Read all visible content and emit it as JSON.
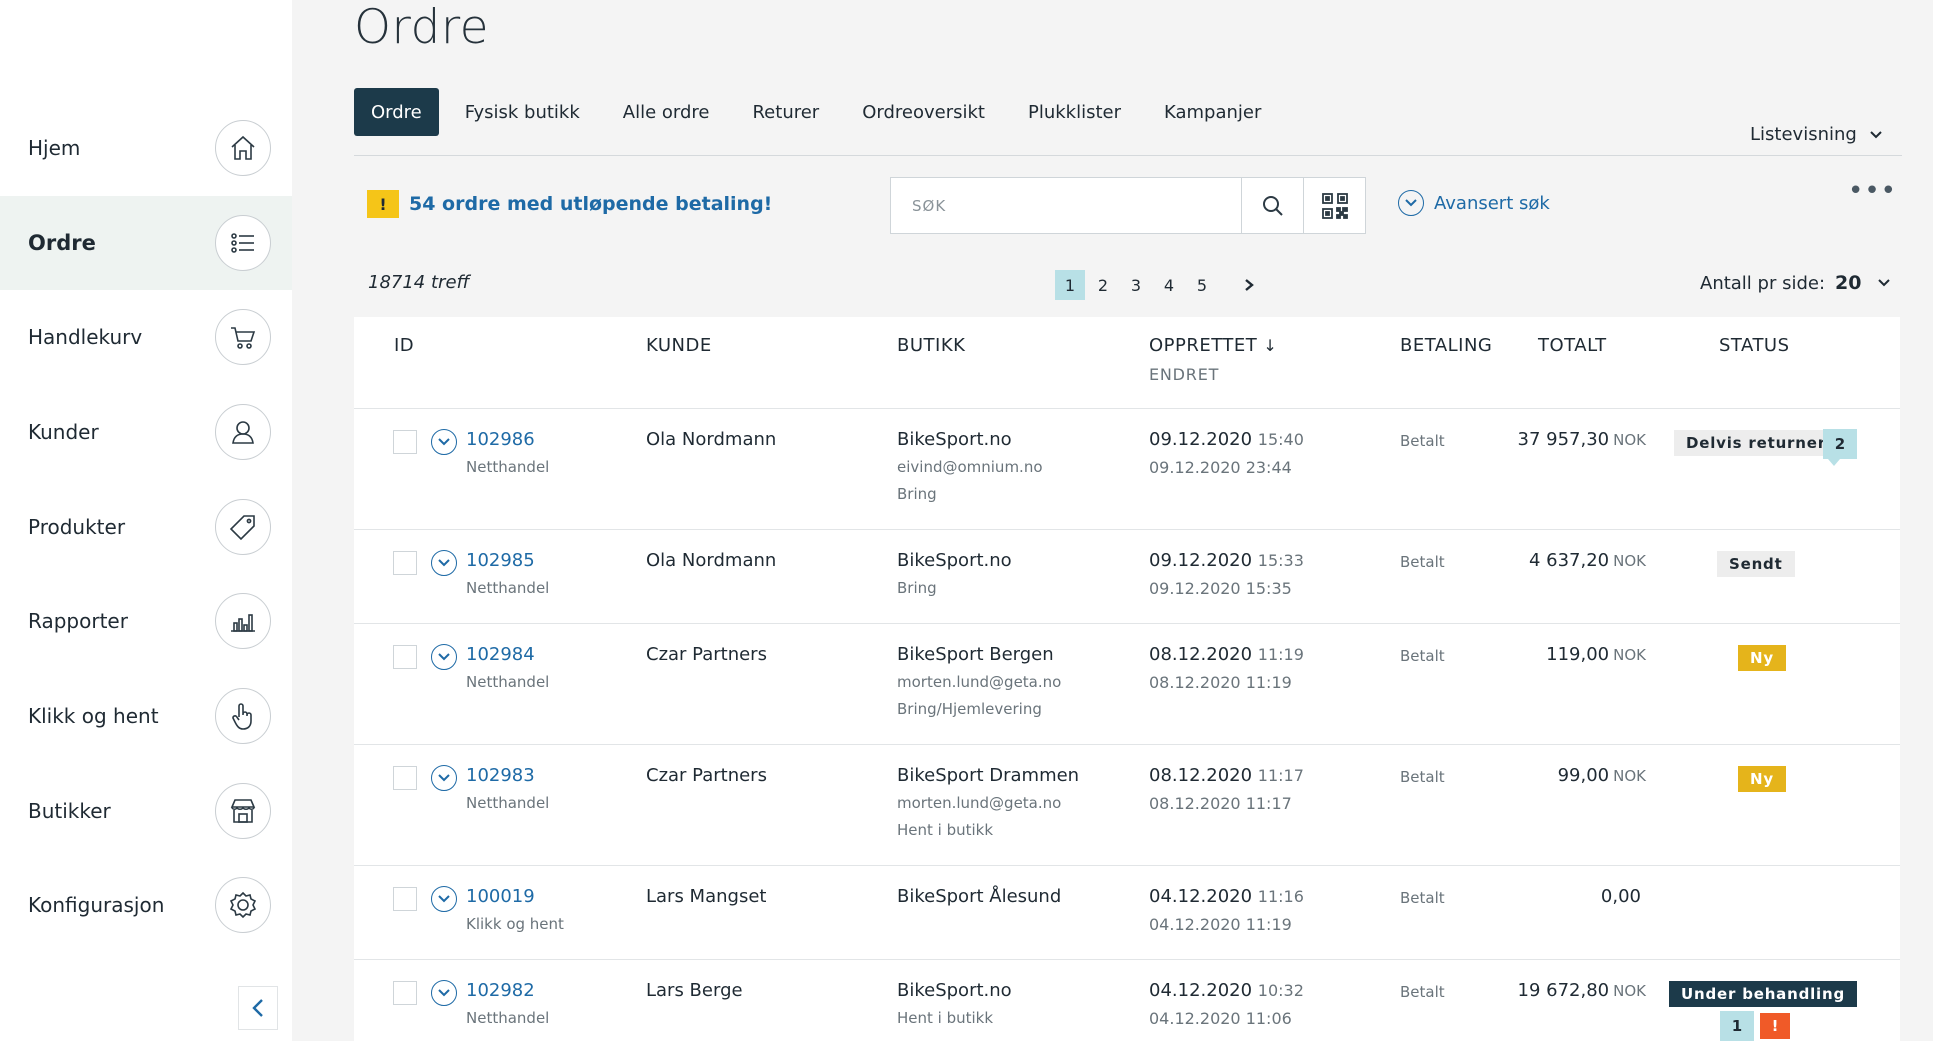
{
  "sidebar": {
    "items": [
      {
        "label": "Hjem",
        "icon": "home-icon"
      },
      {
        "label": "Ordre",
        "icon": "list-icon"
      },
      {
        "label": "Handlekurv",
        "icon": "cart-icon"
      },
      {
        "label": "Kunder",
        "icon": "user-icon"
      },
      {
        "label": "Produkter",
        "icon": "tag-icon"
      },
      {
        "label": "Rapporter",
        "icon": "bar-chart-icon"
      },
      {
        "label": "Klikk og hent",
        "icon": "hand-pointer-icon"
      },
      {
        "label": "Butikker",
        "icon": "store-icon"
      },
      {
        "label": "Konfigurasjon",
        "icon": "gear-icon"
      }
    ],
    "active": "Ordre",
    "collapse_icon": "chevron-left-icon"
  },
  "page": {
    "title": "Ordre"
  },
  "tabs": [
    "Ordre",
    "Fysisk butikk",
    "Alle ordre",
    "Returer",
    "Ordreoversikt",
    "Plukklister",
    "Kampanjer"
  ],
  "view_select": {
    "label": "Listevisning"
  },
  "alert": {
    "badge": "!",
    "text": "54 ordre med utløpende betaling!"
  },
  "search": {
    "placeholder": "SØK"
  },
  "advanced_search": {
    "label": "Avansert søk"
  },
  "more": {
    "label": "•••"
  },
  "results": {
    "hits": "18714 treff"
  },
  "pagination": {
    "pages": [
      "1",
      "2",
      "3",
      "4",
      "5"
    ],
    "current": "1"
  },
  "per_page": {
    "label": "Antall pr side:",
    "value": "20"
  },
  "table": {
    "headers": {
      "id": "ID",
      "customer": "KUNDE",
      "store": "BUTIKK",
      "created": "OPPRETTET",
      "created_sort": "↓",
      "updated": "ENDRET",
      "payment": "BETALING",
      "total": "TOTALT",
      "status": "STATUS"
    },
    "rows": [
      {
        "id": "102986",
        "channel": "Netthandel",
        "customer": "Ola Nordmann",
        "store": "BikeSport.no",
        "store_sub1": "eivind@omnium.no",
        "store_sub2": "Bring",
        "created_date": "09.12.2020",
        "created_time": "15:40",
        "updated": "09.12.2020 23:44",
        "payment": "Betalt",
        "total": "37 957,30",
        "currency": "NOK",
        "status": "Delvis returnert",
        "bubble": "2"
      },
      {
        "id": "102985",
        "channel": "Netthandel",
        "customer": "Ola Nordmann",
        "store": "BikeSport.no",
        "store_sub1": "Bring",
        "store_sub2": "",
        "created_date": "09.12.2020",
        "created_time": "15:33",
        "updated": "09.12.2020 15:35",
        "payment": "Betalt",
        "total": "4 637,20",
        "currency": "NOK",
        "status": "Sendt"
      },
      {
        "id": "102984",
        "channel": "Netthandel",
        "customer": "Czar Partners",
        "store": "BikeSport Bergen",
        "store_sub1": "morten.lund@geta.no",
        "store_sub2": "Bring/Hjemlevering",
        "created_date": "08.12.2020",
        "created_time": "11:19",
        "updated": "08.12.2020 11:19",
        "payment": "Betalt",
        "total": "119,00",
        "currency": "NOK",
        "status": "Ny"
      },
      {
        "id": "102983",
        "channel": "Netthandel",
        "customer": "Czar Partners",
        "store": "BikeSport Drammen",
        "store_sub1": "morten.lund@geta.no",
        "store_sub2": "Hent i butikk",
        "created_date": "08.12.2020",
        "created_time": "11:17",
        "updated": "08.12.2020 11:17",
        "payment": "Betalt",
        "total": "99,00",
        "currency": "NOK",
        "status": "Ny"
      },
      {
        "id": "100019",
        "channel": "Klikk og hent",
        "customer": "Lars Mangset",
        "store": "BikeSport Ålesund",
        "store_sub1": "",
        "store_sub2": "",
        "created_date": "04.12.2020",
        "created_time": "11:16",
        "updated": "04.12.2020 11:19",
        "payment": "Betalt",
        "total": "0,00",
        "currency": "",
        "status": ""
      },
      {
        "id": "102982",
        "channel": "Netthandel",
        "customer": "Lars Berge",
        "store": "BikeSport.no",
        "store_sub1": "Hent i butikk",
        "store_sub2": "",
        "created_date": "04.12.2020",
        "created_time": "10:32",
        "updated": "04.12.2020 11:06",
        "payment": "Betalt",
        "total": "19 672,80",
        "currency": "NOK",
        "status": "Under behandling",
        "bubble": "1",
        "bubble2": "!"
      }
    ]
  },
  "colors": {
    "accent": "#1e6aa6",
    "dark": "#1c3a4a",
    "warning": "#f5c518",
    "status_new": "#e5b41b",
    "bubble": "#b8e0e6",
    "alert_red": "#f05a28"
  }
}
